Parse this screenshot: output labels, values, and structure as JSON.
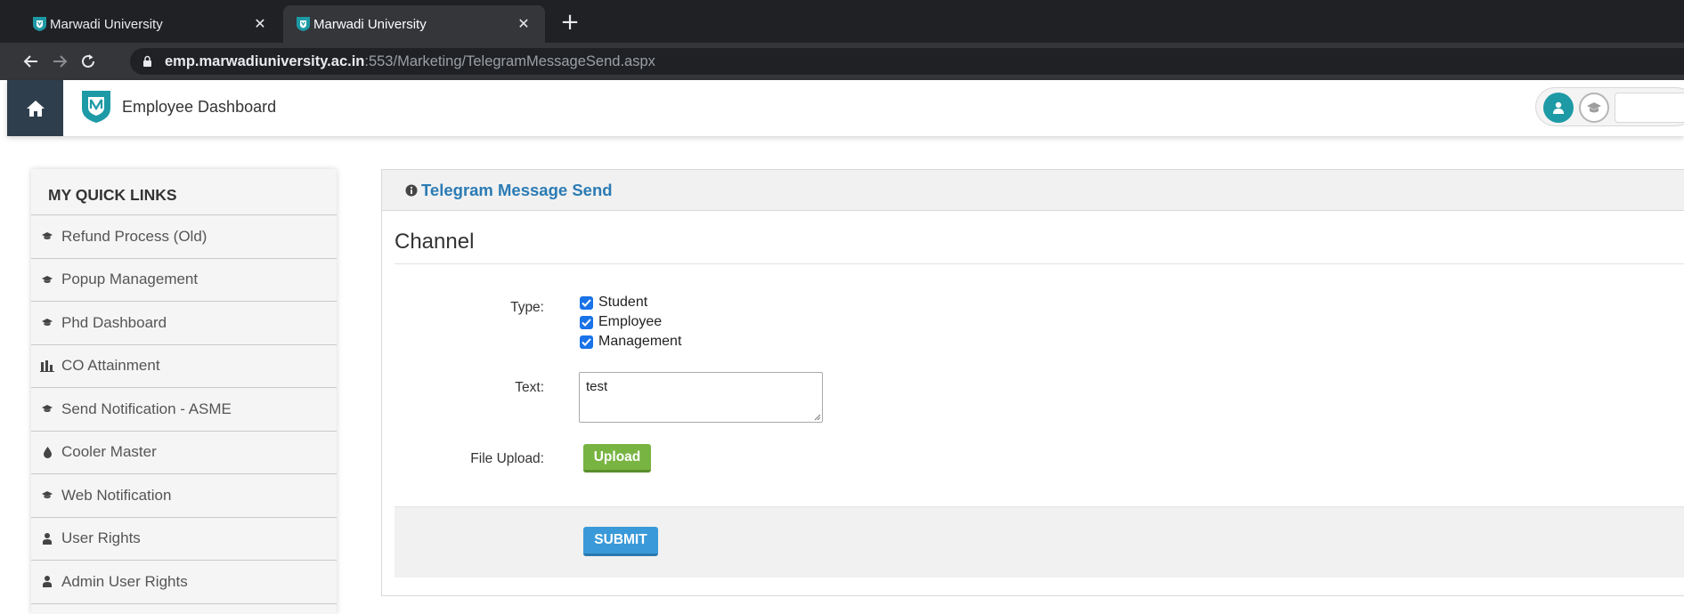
{
  "browser": {
    "tabs": [
      {
        "title": "Marwadi University",
        "active": false
      },
      {
        "title": "Marwadi University",
        "active": true
      }
    ],
    "close_glyph": "✕",
    "new_tab_glyph": "+",
    "url_host": "emp.marwadiuniversity.ac.in",
    "url_rest": ":553/Marketing/TelegramMessageSend.aspx"
  },
  "header": {
    "title": "Employee Dashboard"
  },
  "sidebar": {
    "heading": "MY QUICK LINKS",
    "items": [
      {
        "label": "Refund Process (Old)",
        "icon": "graduation-cap-icon"
      },
      {
        "label": "Popup Management",
        "icon": "graduation-cap-icon"
      },
      {
        "label": "Phd Dashboard",
        "icon": "graduation-cap-icon"
      },
      {
        "label": "CO Attainment",
        "icon": "bar-chart-icon"
      },
      {
        "label": "Send Notification - ASME",
        "icon": "graduation-cap-icon"
      },
      {
        "label": "Cooler Master",
        "icon": "droplet-icon"
      },
      {
        "label": "Web Notification",
        "icon": "graduation-cap-icon"
      },
      {
        "label": "User Rights",
        "icon": "user-icon"
      },
      {
        "label": "Admin User Rights",
        "icon": "user-icon"
      }
    ]
  },
  "panel": {
    "title": "Telegram Message Send",
    "section": "Channel",
    "type_label": "Type:",
    "type_options": [
      {
        "label": "Student",
        "checked": true
      },
      {
        "label": "Employee",
        "checked": true
      },
      {
        "label": "Management",
        "checked": true
      }
    ],
    "text_label": "Text:",
    "text_value": "test",
    "file_label": "File Upload:",
    "upload_button": "Upload",
    "submit_button": "SUBMIT"
  },
  "colors": {
    "accent_blue": "#2b7bb4",
    "upload_green": "#78b442",
    "submit_blue": "#3a9ad9",
    "header_dark": "#2f3e4c",
    "avatar_teal": "#1d9aa5"
  }
}
